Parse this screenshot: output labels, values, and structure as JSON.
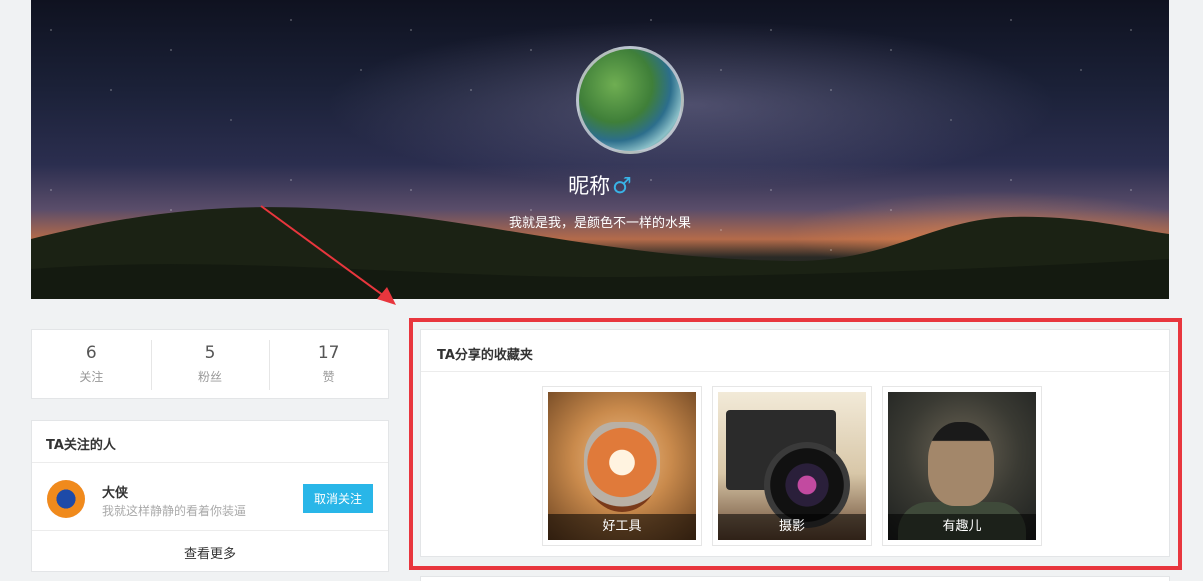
{
  "profile": {
    "nickname": "昵称",
    "gender_icon": "male-icon",
    "gender_symbol": "♂",
    "signature": "我就是我，是颜色不一样的水果"
  },
  "stats": [
    {
      "value": "6",
      "label": "关注"
    },
    {
      "value": "5",
      "label": "粉丝"
    },
    {
      "value": "17",
      "label": "赞"
    }
  ],
  "following": {
    "title": "TA关注的人",
    "items": [
      {
        "name": "大侠",
        "desc": "我就这样静静的看着你装逼",
        "button": "取消关注",
        "avatar_icon": "firefox-icon"
      }
    ],
    "see_more": "查看更多"
  },
  "collections": {
    "title": "TA分享的收藏夹",
    "folders": [
      {
        "label": "好工具"
      },
      {
        "label": "摄影"
      },
      {
        "label": "有趣儿"
      }
    ]
  },
  "colors": {
    "accent": "#29b6e8",
    "highlight": "#e8363d",
    "gender": "#39b3e6"
  }
}
